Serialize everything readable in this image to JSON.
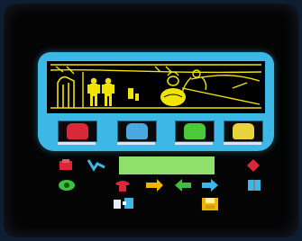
{
  "screen": {
    "background": "#040404"
  },
  "scene": {
    "frame_color": "#3db8e6",
    "line_color": "#f0e400",
    "characters": [
      "doorway-icon",
      "man-icon",
      "man-icon",
      "guard-icon",
      "mummy-icon",
      "sphere-icon"
    ]
  },
  "inventory": {
    "slots": [
      {
        "icon": "red-face-icon",
        "color": "#d8283a"
      },
      {
        "icon": "blue-face-icon",
        "color": "#4aa8e0"
      },
      {
        "icon": "green-face-icon",
        "color": "#4aca3a"
      },
      {
        "icon": "yellow-face-icon",
        "color": "#e8d43a"
      }
    ]
  },
  "status_bar": {
    "color": "#8ee06a",
    "text": ""
  },
  "controls": {
    "icons": [
      "pick-up-icon",
      "walk-icon",
      "eye-icon",
      "telephone-icon",
      "give-icon",
      "swap-icon",
      "back-arrow-icon",
      "book-icon",
      "diamond-icon",
      "disk-icon",
      "hands-icon"
    ]
  }
}
